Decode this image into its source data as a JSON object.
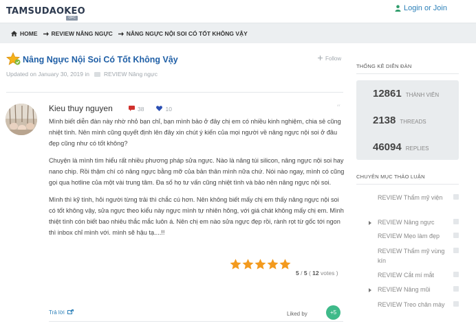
{
  "header": {
    "logo_text": "TAMSUDAOKEO",
    "logo_sub": "OFC",
    "login_label": "Login or Join"
  },
  "breadcrumb": [
    "HOME",
    "REVIEW NÂNG NGỰC",
    "NÂNG NGỰC NỘI SOI CÓ TỐT KHÔNG VẬY"
  ],
  "thread": {
    "title": "Nâng Ngực Nội Soi Có Tốt Không Vậy",
    "follow_label": "Follow",
    "updated_text": "Updated on January 30, 2019 in",
    "category": "REVIEW Nâng ngực"
  },
  "post": {
    "author": "Kieu thuy nguyen",
    "comments_count": "38",
    "likes_count": "10",
    "paragraphs": [
      "Mình biết diễn đàn này nhờ nhỏ bạn chỉ, bạn mình bảo ở đây chị em có nhiều kinh nghiệm, chia sẻ cũng nhiệt tình. Nên mình cũng quyết định lên đây xin chút ý kiến của mọi người về nâng ngực nội soi ở đâu đẹp cũng như có tốt không?",
      "Chuyện là mình tìm hiểu rất nhiều phương pháp sửa ngực. Nào là nâng túi silicon, nâng ngực nội soi hay nano chip. Rồi thậm chí có nâng ngực bằng mỡ của bản thân mình nữa chứ. Nói nào ngay, mình có cũng gọi qua hotline của một vài trung tâm. Đa số họ tư vấn cũng nhiệt tình và bảo nên nâng ngực nội soi.",
      "Mình thì kỹ tính, hỏi người từng trải thì chắc cú hơn. Nên không biết mấy chị em thấy nâng ngực nội soi có tốt không vậy, sửa ngực theo kiểu này ngực mình tự nhiên hông, với giá chát không mấy chị em. Mình thiệt tình cón biết bao nhiêu thắc mắc luôn á. Nên chị em nào sửa ngực đẹp rồi, rành rọt  từ gốc tới ngon thì inbox chỉ mình với. mình sẽ hậu tạ....!!"
    ],
    "rating": {
      "stars": 5,
      "score": "5",
      "max": "5",
      "votes": "12",
      "text_prefix": "/",
      "votes_label": "votes"
    },
    "reply_label": "Trả lời",
    "liked_by_label": "Liked by",
    "likes_badge": "+5"
  },
  "sidebar": {
    "stats_title": "THỐNG KÊ DIỄN ĐÀN",
    "stats": [
      {
        "value": "12861",
        "label": "THÀNH VIÊN"
      },
      {
        "value": "2138",
        "label": "THREADS"
      },
      {
        "value": "46094",
        "label": "REPLIES"
      }
    ],
    "categories_title": "CHUYÊN MỤC THẢO LUẬN",
    "categories": [
      {
        "name": "REVIEW Thẩm mỹ viện",
        "has_children": false
      },
      {
        "name": "REVIEW Nâng ngực",
        "has_children": true
      },
      {
        "name": "REVIEW Mẹo làm đẹp",
        "has_children": false
      },
      {
        "name": "REVIEW Thẩm mỹ vùng kín",
        "has_children": false
      },
      {
        "name": "REVIEW Cắt mí mắt",
        "has_children": false
      },
      {
        "name": "REVIEW Nâng mũi",
        "has_children": true
      },
      {
        "name": "REVIEW Treo chân mày",
        "has_children": false
      }
    ]
  },
  "colors": {
    "link": "#2a7fb8",
    "title": "#1f5fa6",
    "star": "#f39a1e",
    "badge": "#3fba8a"
  }
}
